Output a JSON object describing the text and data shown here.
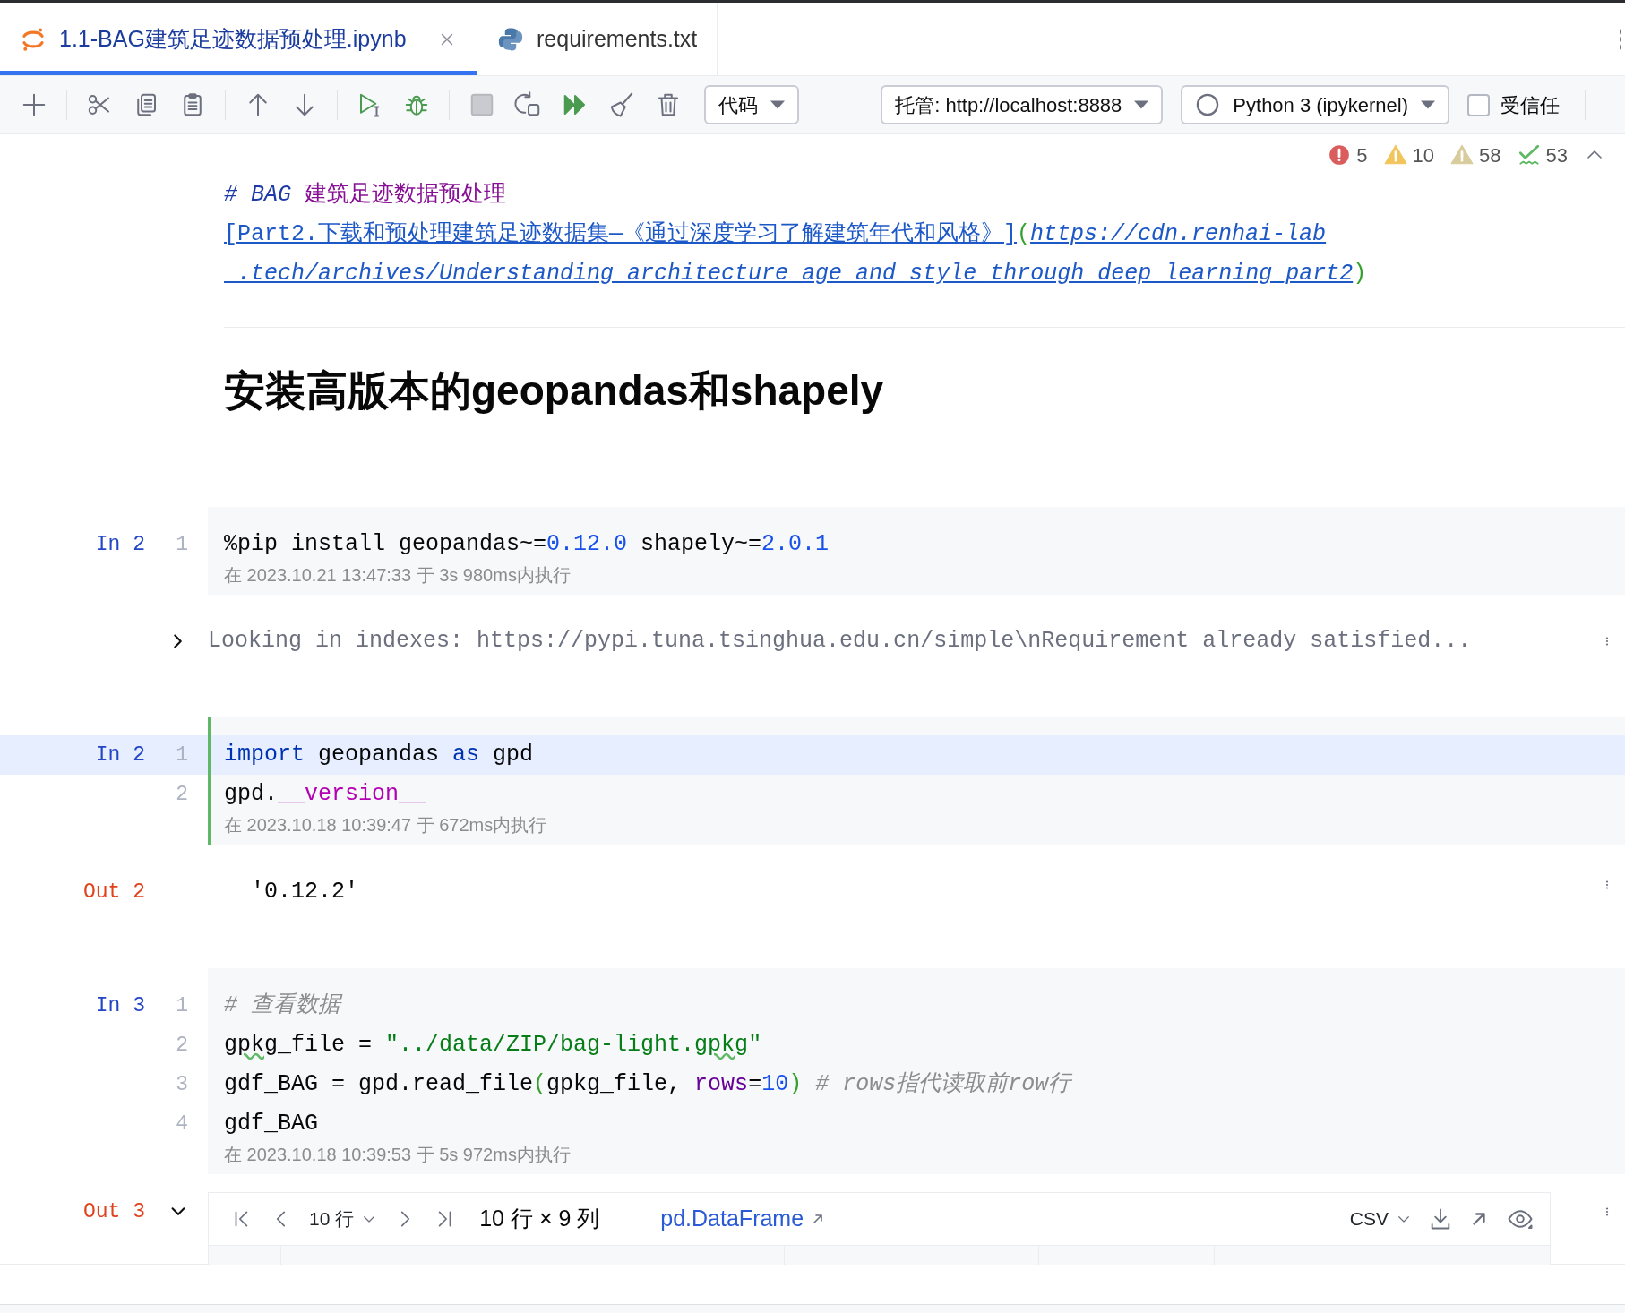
{
  "tabs": [
    {
      "label": "1.1-BAG建筑足迹数据预处理.ipynb",
      "kind": "notebook",
      "selected": true,
      "closable": true
    },
    {
      "label": "requirements.txt",
      "kind": "python",
      "selected": false,
      "closable": false
    }
  ],
  "toolbar": {
    "cell_type": "代码",
    "server": "托管: http://localhost:8888",
    "kernel": "Python 3 (ipykernel)",
    "trusted": {
      "label": "受信任",
      "checked": false
    }
  },
  "inspections": [
    {
      "kind": "error",
      "count": "5"
    },
    {
      "kind": "warning",
      "count": "10"
    },
    {
      "kind": "weak_warning",
      "count": "58"
    },
    {
      "kind": "typo",
      "count": "53"
    }
  ],
  "cells": [
    {
      "kind": "markdown-source",
      "lines": [
        [
          {
            "text": "# BAG",
            "kind": "md-marker"
          },
          {
            "text": " 建筑足迹数据预处理",
            "kind": "md-heading"
          }
        ],
        [
          {
            "text": "[Part2.下载和预处理建筑足迹数据集—《通过深度学习了解建筑年代和风格》]",
            "kind": "md-link"
          },
          {
            "text": "(",
            "kind": "brace"
          },
          {
            "text": "https://cdn.renhai-lab",
            "kind": "md-url"
          }
        ],
        [
          {
            "text": " .tech/archives/Understanding_architecture_age_and_style_through_deep_learning_part2",
            "kind": "md-url"
          },
          {
            "text": ")",
            "kind": "brace"
          }
        ]
      ]
    },
    {
      "kind": "markdown-rendered",
      "heading": "安装高版本的geopandas和shapely"
    },
    {
      "kind": "code",
      "prompt": "In 2",
      "selected": false,
      "executed": "在 2023.10.21 13:47:33 于 3s 980ms内执行",
      "lines": [
        {
          "number": "1",
          "current": false,
          "tokens": [
            {
              "text": "%pip install geopandas~=",
              "kind": "plain"
            },
            {
              "text": "0.12.0",
              "kind": "number"
            },
            {
              "text": " shapely~=",
              "kind": "plain"
            },
            {
              "text": "2.0.1",
              "kind": "number"
            }
          ]
        }
      ],
      "output": {
        "kind": "text",
        "expanded": false,
        "text": "Looking in indexes: https://pypi.tuna.tsinghua.edu.cn/simple\\nRequirement already satisfied..."
      }
    },
    {
      "kind": "code",
      "prompt": "In 2",
      "selected": true,
      "executed": "在 2023.10.18 10:39:47 于 672ms内执行",
      "lines": [
        {
          "number": "1",
          "current": true,
          "tokens": [
            {
              "text": "import",
              "kind": "keyword"
            },
            {
              "text": " geopandas ",
              "kind": "plain"
            },
            {
              "text": "as",
              "kind": "keyword"
            },
            {
              "text": " gpd",
              "kind": "plain"
            }
          ]
        },
        {
          "number": "2",
          "current": false,
          "tokens": [
            {
              "text": "gpd.",
              "kind": "plain"
            },
            {
              "text": "__version__",
              "kind": "dunder"
            }
          ]
        }
      ],
      "output": {
        "kind": "value",
        "prompt": "Out 2",
        "text": "'0.12.2'"
      }
    },
    {
      "kind": "code",
      "prompt": "In 3",
      "selected": false,
      "executed": "在 2023.10.18 10:39:53 于 5s 972ms内执行",
      "lines": [
        {
          "number": "1",
          "current": false,
          "tokens": [
            {
              "text": "# 查看数据",
              "kind": "comment"
            }
          ]
        },
        {
          "number": "2",
          "current": false,
          "tokens": [
            {
              "text": "gpkg",
              "kind": "typo"
            },
            {
              "text": "_file = ",
              "kind": "plain"
            },
            {
              "text": "\"../data/ZIP/bag-light.",
              "kind": "string"
            },
            {
              "text": "gpkg",
              "kind": "string-typo"
            },
            {
              "text": "\"",
              "kind": "string"
            }
          ]
        },
        {
          "number": "3",
          "current": false,
          "tokens": [
            {
              "text": "gdf_BAG = gpd.read_file",
              "kind": "plain"
            },
            {
              "text": "(",
              "kind": "brace"
            },
            {
              "text": "gpkg_file, ",
              "kind": "plain"
            },
            {
              "text": "rows",
              "kind": "param"
            },
            {
              "text": "=",
              "kind": "plain"
            },
            {
              "text": "10",
              "kind": "number"
            },
            {
              "text": ")",
              "kind": "brace"
            },
            {
              "text": " # rows指代读取前row行",
              "kind": "comment"
            }
          ]
        },
        {
          "number": "4",
          "current": false,
          "tokens": [
            {
              "text": "gdf_BAG",
              "kind": "plain"
            }
          ]
        }
      ],
      "output": {
        "kind": "dataframe",
        "prompt": "Out 3",
        "expanded": true,
        "page_size": "10 行",
        "shape": "10 行 × 9 列",
        "type_link": "pd.DataFrame",
        "format": "CSV"
      }
    }
  ]
}
